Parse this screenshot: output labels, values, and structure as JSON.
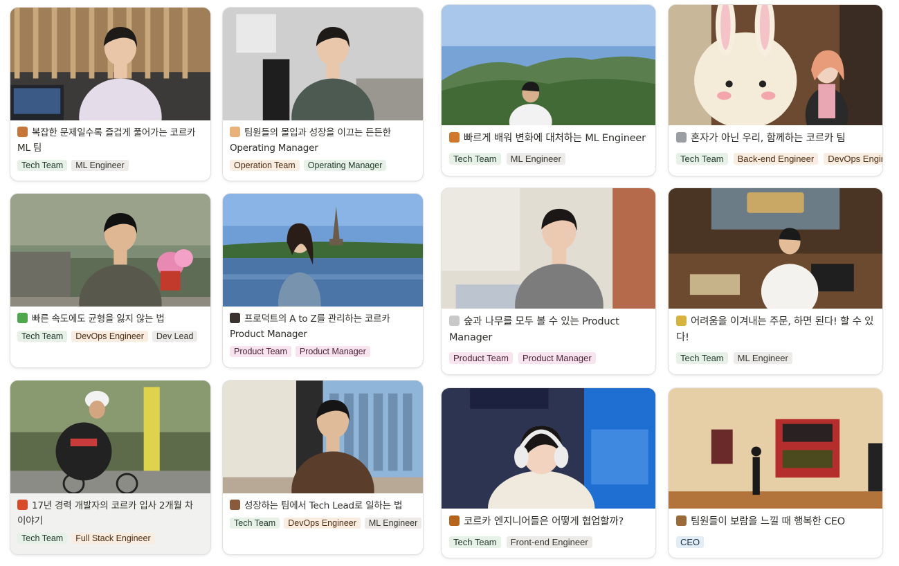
{
  "gallery": {
    "cards": [
      {
        "title": "복잡한 문제일수록 즐겁게 풀어가는 코르카 ML 팀",
        "emoji_icon": "sweet-potato-icon",
        "emoji_color": "#c7763a",
        "tags": [
          {
            "label": "Tech Team",
            "color": "green"
          },
          {
            "label": "ML Engineer",
            "color": "gray"
          }
        ]
      },
      {
        "title": "팀원들의 몰입과 성장을 이끄는 든든한 Operating Manager",
        "emoji_icon": "shell-icon",
        "emoji_color": "#e9b27a",
        "tags": [
          {
            "label": "Operation Team",
            "color": "orange"
          },
          {
            "label": "Operating Manager",
            "color": "green"
          }
        ]
      },
      {
        "title": "빠르게 배워 변화에 대처하는 ML Engineer",
        "emoji_icon": "seahorse-icon",
        "emoji_color": "#d2782c",
        "tags": [
          {
            "label": "Tech Team",
            "color": "green"
          },
          {
            "label": "ML Engineer",
            "color": "gray"
          }
        ]
      },
      {
        "title": "혼자가 아닌 우리, 함께하는 코르카 팀",
        "emoji_icon": "shoe-icon",
        "emoji_color": "#9b9ea3",
        "tags": [
          {
            "label": "Tech Team",
            "color": "green"
          },
          {
            "label": "Back-end Engineer",
            "color": "orange"
          },
          {
            "label": "DevOps Engineer",
            "color": "orange"
          }
        ]
      },
      {
        "title": "빠른 속도에도 균형을 잃지 않는 법",
        "emoji_icon": "chameleon-icon",
        "emoji_color": "#4fa74b",
        "tags": [
          {
            "label": "Tech Team",
            "color": "green"
          },
          {
            "label": "DevOps Engineer",
            "color": "orange"
          },
          {
            "label": "Dev Lead",
            "color": "gray"
          }
        ]
      },
      {
        "title": "프로덕트의 A to Z를 관리하는 코르카 Product Manager",
        "emoji_icon": "woman-icon",
        "emoji_color": "#3a3230",
        "tags": [
          {
            "label": "Product Team",
            "color": "pink"
          },
          {
            "label": "Product Manager",
            "color": "pink"
          }
        ]
      },
      {
        "title": "숲과 나무를 모두 볼 수 있는 Product Manager",
        "emoji_icon": "goat-icon",
        "emoji_color": "#c9c9c9",
        "tags": [
          {
            "label": "Product Team",
            "color": "pink"
          },
          {
            "label": "Product Manager",
            "color": "pink"
          }
        ]
      },
      {
        "title": "어려움을 이겨내는 주문, 하면 된다! 할 수 있다!",
        "emoji_icon": "ghost-icon",
        "emoji_color": "#d8b23e",
        "tags": [
          {
            "label": "Tech Team",
            "color": "green"
          },
          {
            "label": "ML Engineer",
            "color": "gray"
          }
        ]
      },
      {
        "title": "17년 경력 개발자의 코르카 입사 2개월 차 이야기",
        "emoji_icon": "rooster-icon",
        "emoji_color": "#d94a2b",
        "tags": [
          {
            "label": "Tech Team",
            "color": "green"
          },
          {
            "label": "Full Stack Engineer",
            "color": "orange"
          }
        ]
      },
      {
        "title": "성장하는 팀에서 Tech Lead로 일하는 법",
        "emoji_icon": "man-icon",
        "emoji_color": "#8a5a3c",
        "tags": [
          {
            "label": "Tech Team",
            "color": "green"
          },
          {
            "label": "DevOps Engineer",
            "color": "orange"
          },
          {
            "label": "ML Engineer",
            "color": "gray"
          }
        ]
      },
      {
        "title": "코르카 엔지니어들은 어떻게 협업할까?",
        "emoji_icon": "dog-icon",
        "emoji_color": "#b5651d",
        "tags": [
          {
            "label": "Tech Team",
            "color": "green"
          },
          {
            "label": "Front-end Engineer",
            "color": "gray"
          }
        ]
      },
      {
        "title": "팀원들이 보람을 느낄 때 행복한 CEO",
        "emoji_icon": "person-icon",
        "emoji_color": "#9a6a3a",
        "tags": [
          {
            "label": "CEO",
            "color": "blue"
          }
        ]
      }
    ]
  }
}
